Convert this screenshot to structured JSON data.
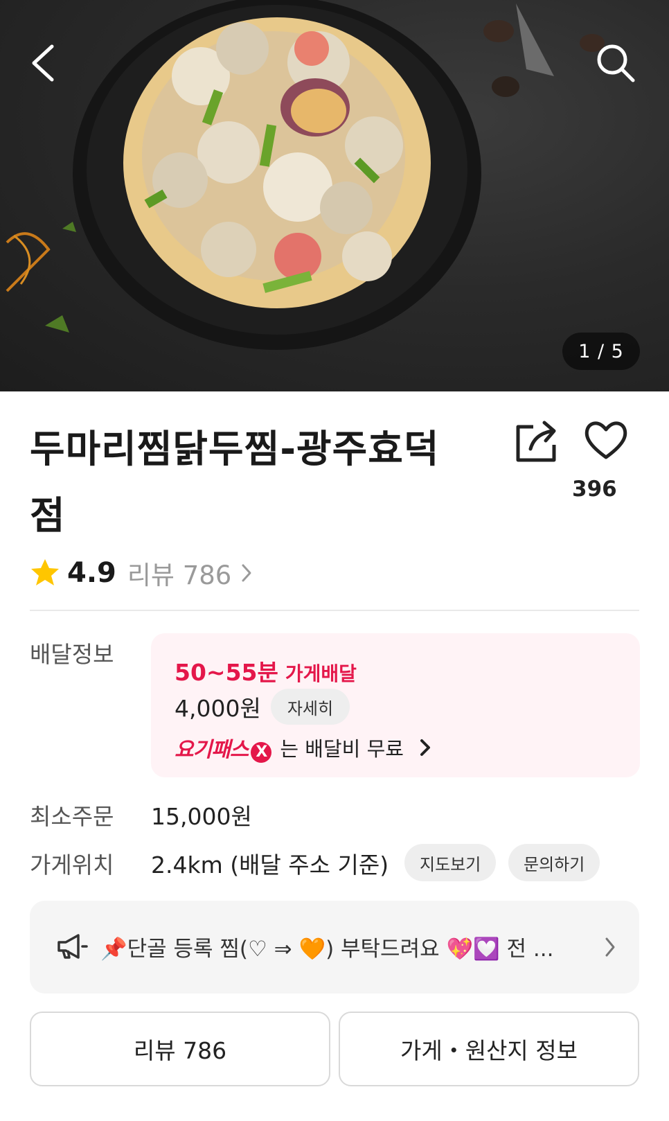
{
  "hero": {
    "image_alt": "food-photo",
    "counter": "1 / 5",
    "back_icon": "chevron-left-icon",
    "search_icon": "search-icon"
  },
  "store": {
    "title": "두마리찜닭두찜-광주효덕점",
    "like_count": "396",
    "rating": "4.9",
    "review_link": "리뷰 786"
  },
  "delivery": {
    "label": "배달정보",
    "time": "50~55분",
    "type": "가게배달",
    "fee": "4,000원",
    "detail_button": "자세히",
    "promo_logo": "요기패스",
    "promo_logo_x": "X",
    "promo_text": "는 배달비 무료"
  },
  "min_order": {
    "label": "최소주문",
    "value": "15,000원"
  },
  "location": {
    "label": "가게위치",
    "value": "2.4km (배달 주소 기준)",
    "map_button": "지도보기",
    "inquiry_button": "문의하기"
  },
  "notice": {
    "text": "📌단골 등록 찜(♡ ⇒ 🧡) 부탁드려요 💖💟 전 ..."
  },
  "tabs": {
    "reviews": "리뷰 786",
    "store_info": "가게・원산지 정보"
  },
  "colors": {
    "accent": "#e4174a",
    "delivery_bg": "#fff3f6",
    "star": "#ffc600"
  }
}
